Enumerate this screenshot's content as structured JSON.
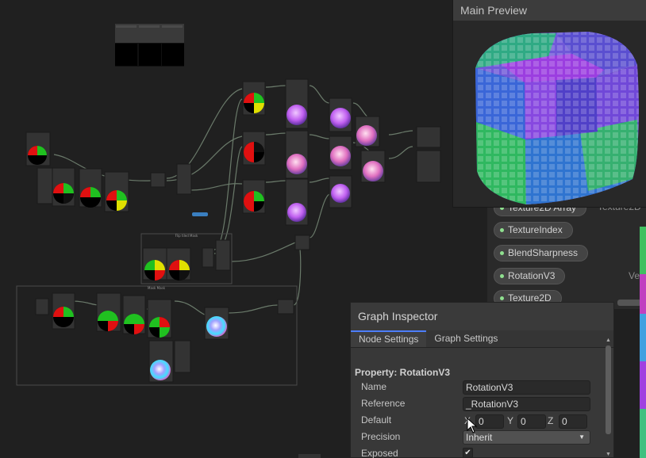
{
  "main_preview": {
    "title": "Main Preview"
  },
  "blackboard": {
    "items": [
      {
        "label": "Texture2D Array",
        "type": "Texture2D"
      },
      {
        "label": "TextureIndex",
        "type": ""
      },
      {
        "label": "BlendSharpness",
        "type": ""
      },
      {
        "label": "RotationV3",
        "type": "Vec"
      },
      {
        "label": "Texture2D",
        "type": ""
      }
    ]
  },
  "graph": {
    "groups": [
      {
        "title": "Flip tiled Mask"
      },
      {
        "title": "Mask Mask"
      }
    ],
    "reroute_label": "Texture"
  },
  "inspector": {
    "title": "Graph Inspector",
    "tabs": [
      {
        "label": "Node Settings",
        "active": true
      },
      {
        "label": "Graph Settings",
        "active": false
      }
    ],
    "property_title": "Property: RotationV3",
    "rows": {
      "name": {
        "label": "Name",
        "value": "RotationV3"
      },
      "reference": {
        "label": "Reference",
        "value": "_RotationV3"
      },
      "default": {
        "label": "Default",
        "x_label": "X",
        "x": "0",
        "y_label": "Y",
        "y": "0",
        "z_label": "Z",
        "z": "0"
      },
      "precision": {
        "label": "Precision",
        "value": "Inherit"
      },
      "exposed": {
        "label": "Exposed",
        "checked": "✔"
      }
    }
  },
  "colors": {
    "accent": "#4c7eff",
    "background": "#202020",
    "panel": "#383838"
  }
}
